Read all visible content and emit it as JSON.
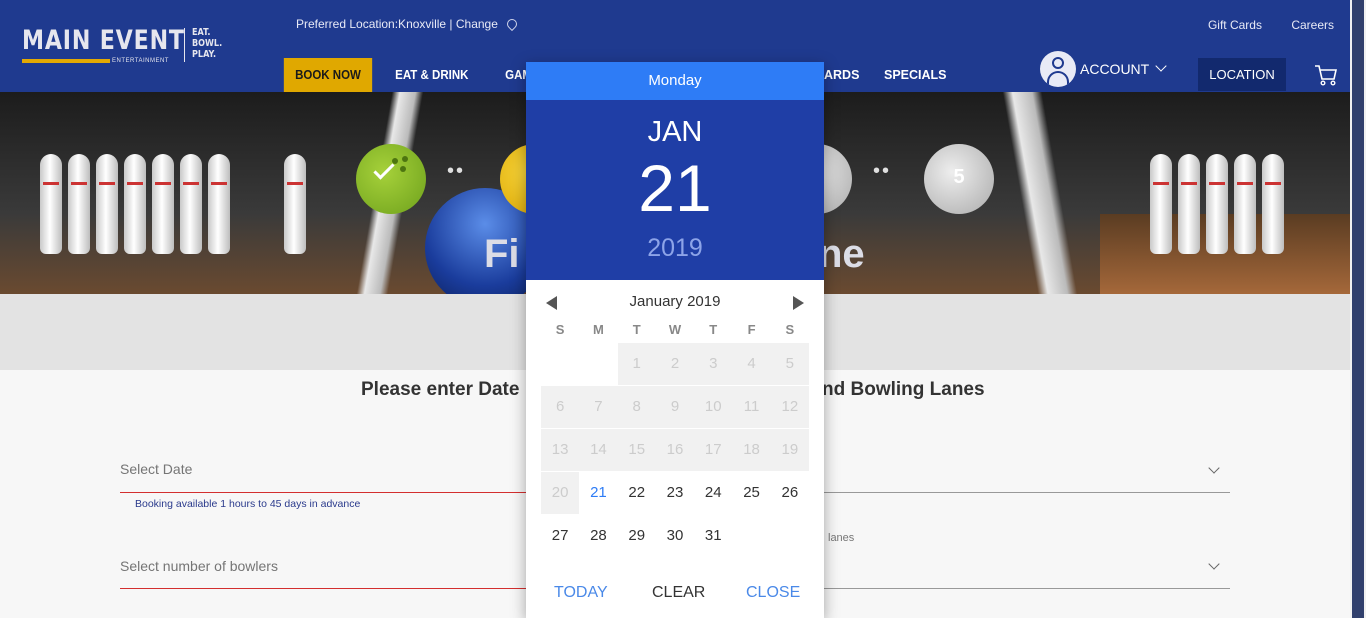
{
  "header": {
    "logo_main": "MAIN EVENT",
    "logo_sub": "ENTERTAINMENT",
    "logo_tag": [
      "EAT.",
      "BOWL.",
      "PLAY."
    ],
    "preferred_location": "Preferred Location:Knoxville | Change",
    "top_links": [
      "Gift Cards",
      "Careers"
    ],
    "nav": {
      "book_now": "BOOK NOW",
      "eat_drink": "EAT & DRINK",
      "games_partial": "GAM",
      "cards_partial": "ARDS",
      "specials": "SPECIALS"
    },
    "account_label": "ACCOUNT",
    "location_button": "LOCATION",
    "brand_color": "#1f3a8f",
    "accent_color": "#e0a800"
  },
  "banner": {
    "step5_number": "5",
    "title_left": "Fi",
    "title_right": "ne"
  },
  "form": {
    "instructions_left": "Please enter Date",
    "instructions_right": "nd Bowling Lanes",
    "date_label": "Select Date",
    "date_help": "Booking available 1 hours to 45 days in advance",
    "bowlers_label": "Select number of bowlers",
    "lanes_partial": "lanes"
  },
  "datepicker": {
    "weekday": "Monday",
    "month_short": "JAN",
    "day": "21",
    "year": "2019",
    "month_label": "January  2019",
    "weekday_headers": [
      "S",
      "M",
      "T",
      "W",
      "T",
      "F",
      "S"
    ],
    "weeks": [
      [
        "",
        "",
        "1",
        "2",
        "3",
        "4",
        "5"
      ],
      [
        "6",
        "7",
        "8",
        "9",
        "10",
        "11",
        "12"
      ],
      [
        "13",
        "14",
        "15",
        "16",
        "17",
        "18",
        "19"
      ],
      [
        "20",
        "21",
        "22",
        "23",
        "24",
        "25",
        "26"
      ],
      [
        "27",
        "28",
        "29",
        "30",
        "31",
        "",
        ""
      ]
    ],
    "disabled_days": [
      "1",
      "2",
      "3",
      "4",
      "5",
      "6",
      "7",
      "8",
      "9",
      "10",
      "11",
      "12",
      "13",
      "14",
      "15",
      "16",
      "17",
      "18",
      "19",
      "20"
    ],
    "selected_day": "21",
    "today_button": "TODAY",
    "clear_button": "CLEAR",
    "close_button": "CLOSE",
    "header_color": "#2e7cf6",
    "panel_color": "#1f3ea6"
  }
}
